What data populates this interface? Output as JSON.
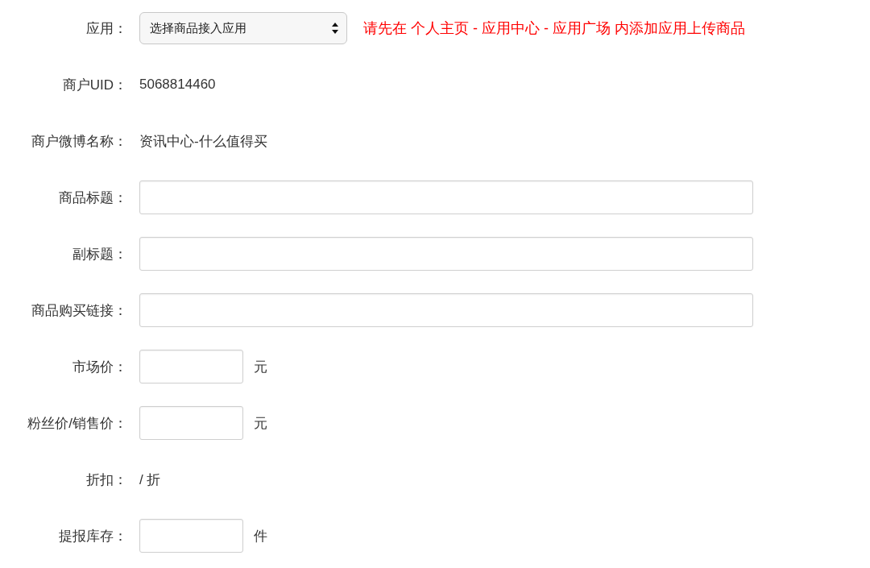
{
  "form": {
    "rows": [
      {
        "kind": "select",
        "label": "应用：",
        "value": "选择商品接入应用",
        "note": "请先在 个人主页 - 应用中心 - 应用广场 内添加应用上传商品"
      },
      {
        "kind": "static",
        "label": "商户UID：",
        "value": "5068814460"
      },
      {
        "kind": "static",
        "label": "商户微博名称：",
        "value": "资讯中心-什么值得买"
      },
      {
        "kind": "input",
        "label": "商品标题："
      },
      {
        "kind": "input",
        "label": "副标题："
      },
      {
        "kind": "input",
        "label": "商品购买链接："
      },
      {
        "kind": "short_input",
        "label": "市场价：",
        "unit": "元"
      },
      {
        "kind": "short_input",
        "label": "粉丝价/销售价：",
        "unit": "元"
      },
      {
        "kind": "static",
        "label": "折扣：",
        "value": "/ 折"
      },
      {
        "kind": "short_input",
        "label": "提报库存：",
        "unit": "件"
      }
    ]
  }
}
